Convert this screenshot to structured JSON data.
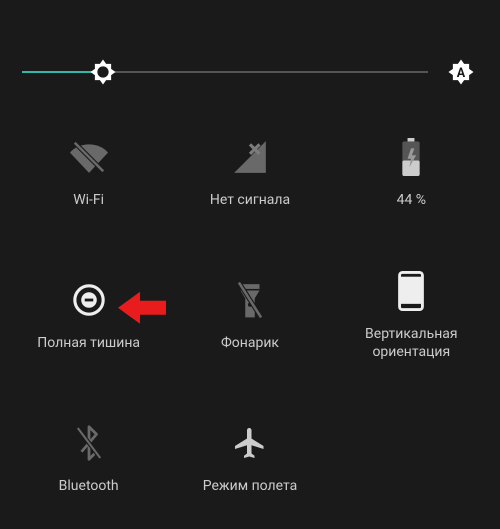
{
  "brightness": {
    "percent": 20,
    "auto_label": "A"
  },
  "tiles": {
    "wifi": {
      "label": "Wi-Fi"
    },
    "signal": {
      "label": "Нет сигнала"
    },
    "battery": {
      "label": "44 %"
    },
    "dnd": {
      "label": "Полная тишина"
    },
    "flashlight": {
      "label": "Фонарик"
    },
    "rotation": {
      "label": "Вертикальная\nориентация"
    },
    "bluetooth": {
      "label": "Bluetooth"
    },
    "airplane": {
      "label": "Режим полета"
    }
  }
}
